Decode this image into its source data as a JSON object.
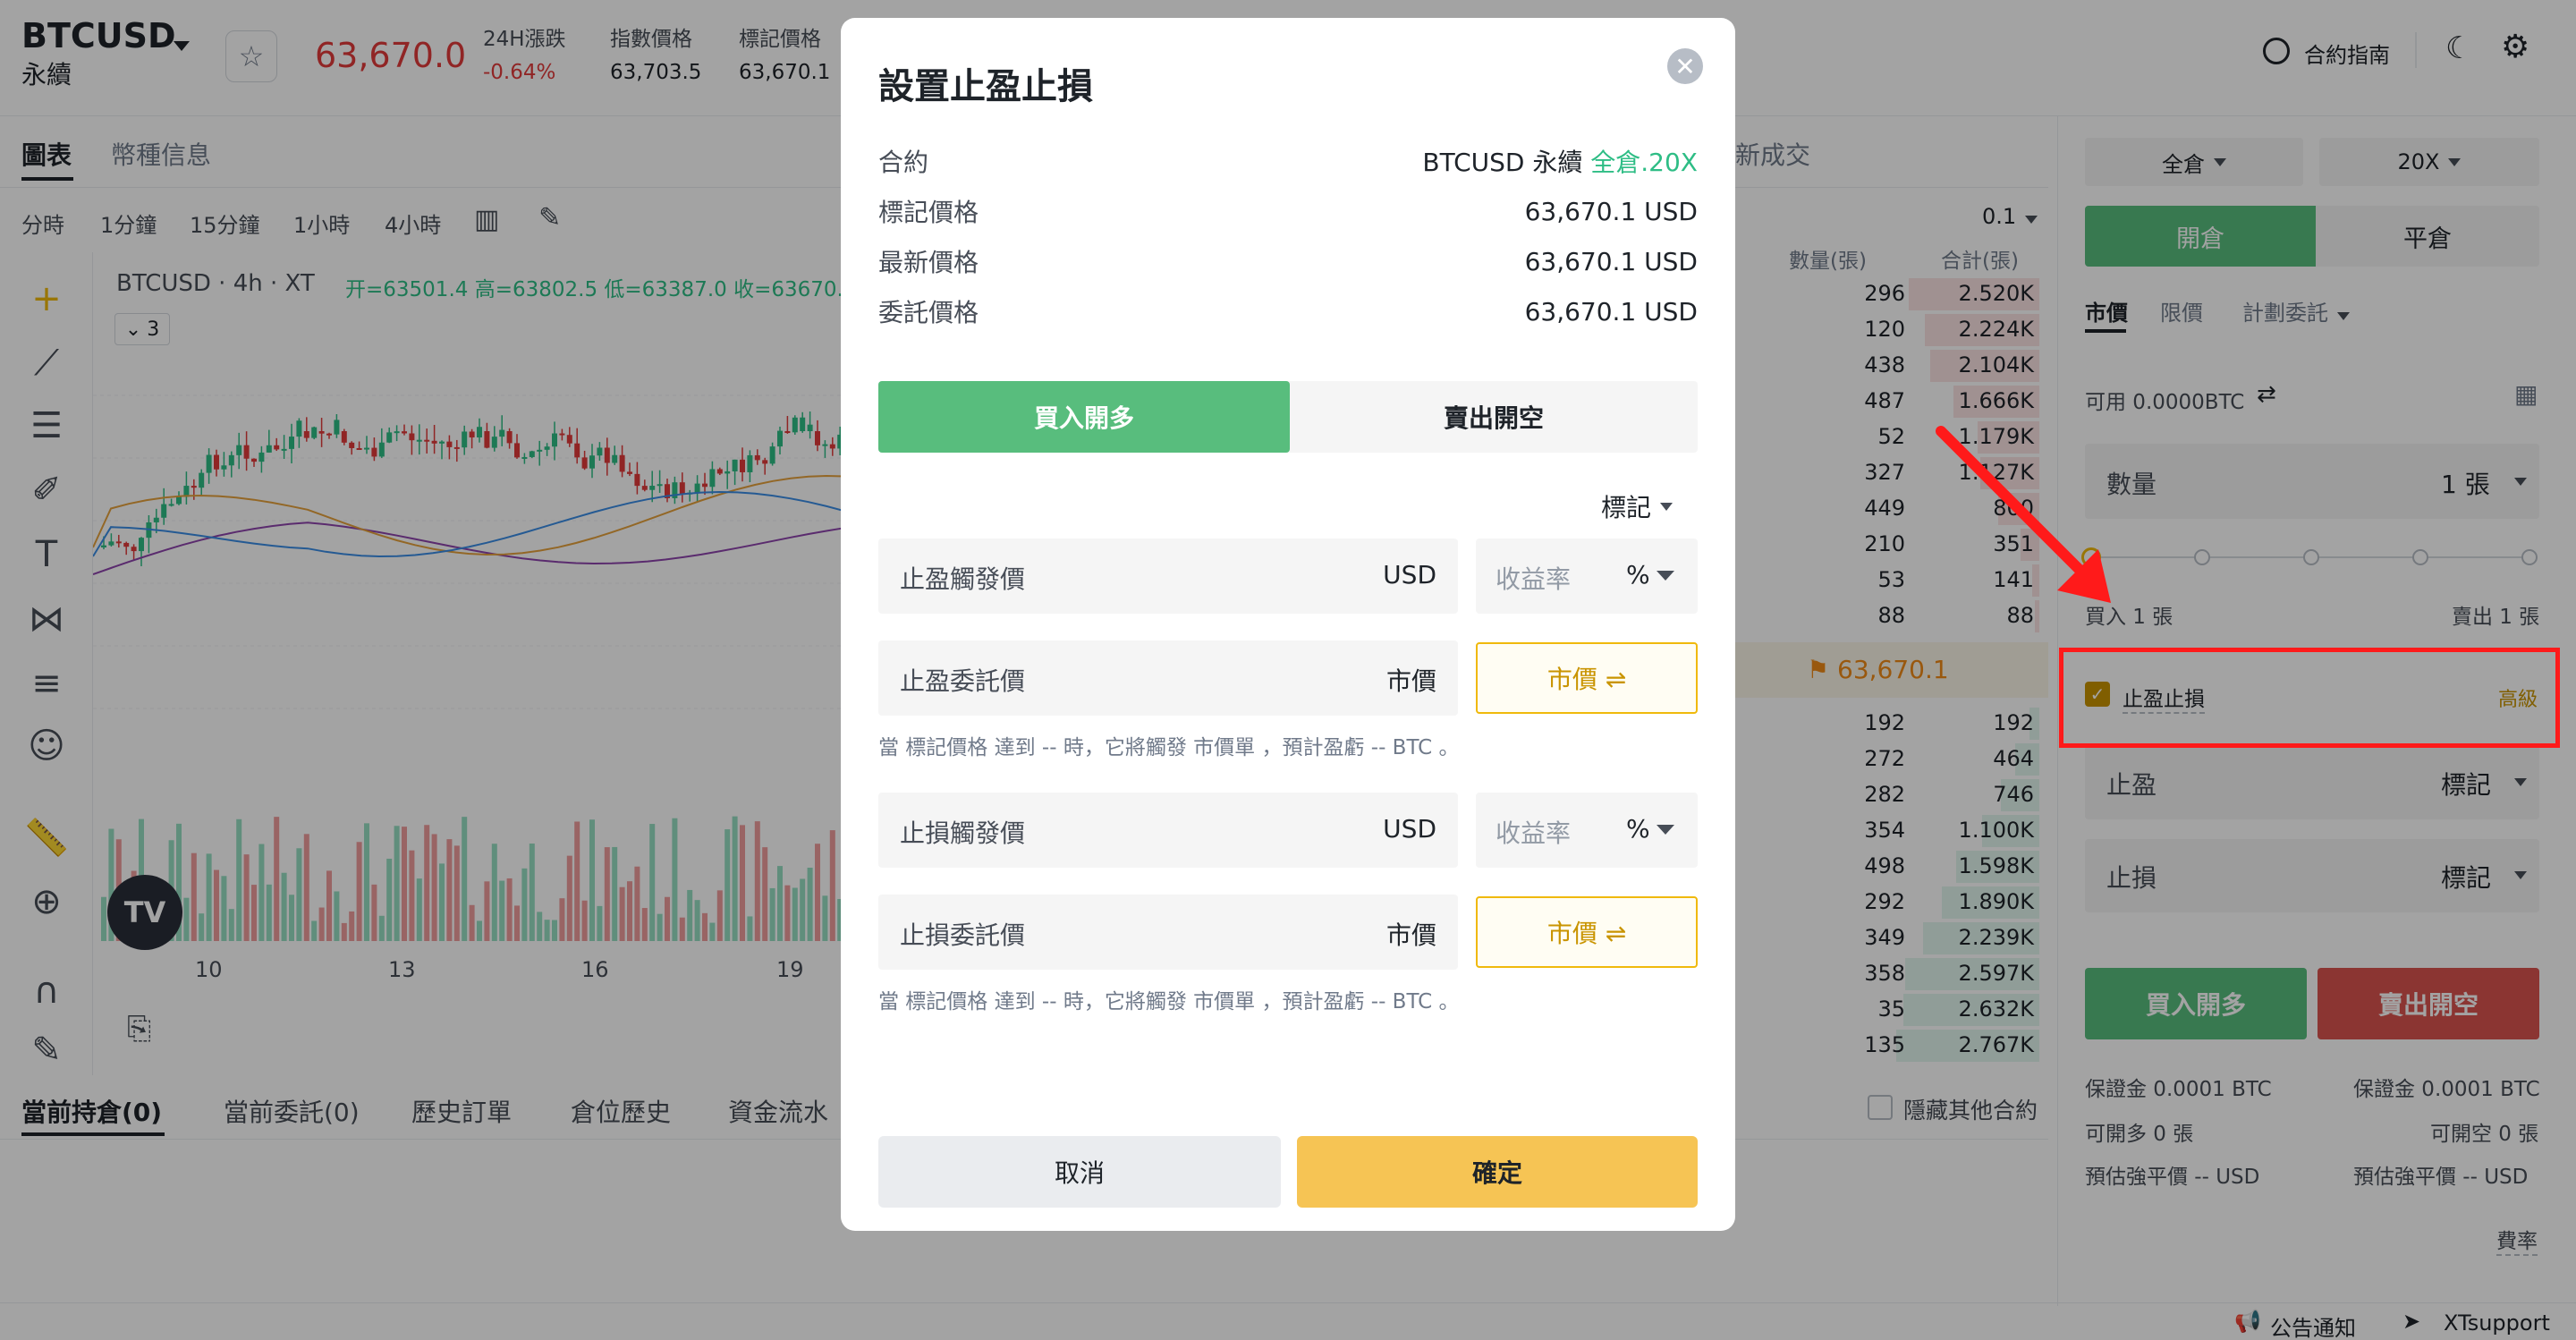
{
  "header": {
    "symbol": "BTCUSD",
    "symbol_sub": "永續",
    "last_price": "63,670.0",
    "stats": [
      {
        "label": "24H漲跌",
        "value": "-0.64%",
        "color": "#e23b3b"
      },
      {
        "label": "指數價格",
        "value": "63,703.5",
        "color": "#1e2329"
      },
      {
        "label": "標記價格",
        "value": "63,670.1",
        "color": "#1e2329"
      }
    ],
    "guide_label": "合約指南"
  },
  "chart_tabs": [
    "圖表",
    "幣種信息"
  ],
  "timeframes": [
    "分時",
    "1分鐘",
    "15分鐘",
    "1小時",
    "4小時"
  ],
  "chart": {
    "title": "BTCUSD · 4h · XT",
    "ohlc": "开=63501.4 高=63802.5 低=63387.0 收=63670.",
    "interval_badge": "3",
    "x_labels": [
      "10",
      "13",
      "16",
      "19"
    ],
    "logo_text": "TV"
  },
  "bottom_tabs": [
    "當前持倉(0)",
    "當前委託(0)",
    "歷史訂單",
    "倉位歷史",
    "資金流水"
  ],
  "hide_others_label": "隱藏其他合約",
  "order_book": {
    "latest_trades_label": "新成交",
    "precision": "0.1",
    "headers": [
      "數量(張)",
      "合計(張)"
    ],
    "asks": [
      {
        "qty": "296",
        "total": "2.520K",
        "depth": 0.91
      },
      {
        "qty": "120",
        "total": "2.224K",
        "depth": 0.8
      },
      {
        "qty": "438",
        "total": "2.104K",
        "depth": 0.76
      },
      {
        "qty": "487",
        "total": "1.666K",
        "depth": 0.6
      },
      {
        "qty": "52",
        "total": "1.179K",
        "depth": 0.43
      },
      {
        "qty": "327",
        "total": "1.127K",
        "depth": 0.41
      },
      {
        "qty": "449",
        "total": "800",
        "depth": 0.29
      },
      {
        "qty": "210",
        "total": "351",
        "depth": 0.13
      },
      {
        "qty": "53",
        "total": "141",
        "depth": 0.05
      },
      {
        "qty": "88",
        "total": "88",
        "depth": 0.03
      }
    ],
    "mid_price": "63,670.1",
    "bids": [
      {
        "qty": "192",
        "total": "192",
        "depth": 0.07
      },
      {
        "qty": "272",
        "total": "464",
        "depth": 0.17
      },
      {
        "qty": "282",
        "total": "746",
        "depth": 0.27
      },
      {
        "qty": "354",
        "total": "1.100K",
        "depth": 0.4
      },
      {
        "qty": "498",
        "total": "1.598K",
        "depth": 0.58
      },
      {
        "qty": "292",
        "total": "1.890K",
        "depth": 0.68
      },
      {
        "qty": "349",
        "total": "2.239K",
        "depth": 0.81
      },
      {
        "qty": "358",
        "total": "2.597K",
        "depth": 0.94
      },
      {
        "qty": "35",
        "total": "2.632K",
        "depth": 0.95
      },
      {
        "qty": "135",
        "total": "2.767K",
        "depth": 1.0
      }
    ]
  },
  "panel": {
    "margin_mode": "全倉",
    "leverage": "20X",
    "open_tab": "開倉",
    "close_tab": "平倉",
    "order_types": [
      "市價",
      "限價",
      "計劃委託"
    ],
    "available": "可用 0.0000BTC",
    "qty_label": "數量",
    "qty_value": "1 張",
    "buy_amount": "買入 1 張",
    "sell_amount": "賣出 1 張",
    "tpsl_label": "止盈止損",
    "advanced_label": "高級",
    "tp_label": "止盈",
    "sl_label": "止損",
    "mark_label": "標記",
    "buy_button": "買入開多",
    "sell_button": "賣出開空",
    "margin_buy": "保證金 0.0001 BTC",
    "margin_sell": "保證金 0.0001 BTC",
    "can_long": "可開多 0 張",
    "can_short": "可開空 0 張",
    "liq_buy": "預估強平價 -- USD",
    "liq_sell": "預估強平價 -- USD",
    "fee_label": "費率"
  },
  "footer": {
    "announce": "公告通知",
    "support": "XTsupport"
  },
  "modal": {
    "title": "設置止盈止損",
    "rows": [
      {
        "key": "合約",
        "value": "BTCUSD 永續",
        "extra": "全倉.20X"
      },
      {
        "key": "標記價格",
        "value": "63,670.1 USD",
        "extra": ""
      },
      {
        "key": "最新價格",
        "value": "63,670.1 USD",
        "extra": ""
      },
      {
        "key": "委託價格",
        "value": "63,670.1 USD",
        "extra": ""
      }
    ],
    "buy_tab": "買入開多",
    "sell_tab": "賣出開空",
    "price_type": "標記",
    "tp_trigger_label": "止盈觸發價",
    "tp_order_label": "止盈委託價",
    "sl_trigger_label": "止損觸發價",
    "sl_order_label": "止損委託價",
    "unit_usd": "USD",
    "unit_market": "市價",
    "yield_label": "收益率",
    "yield_unit": "%",
    "market_btn": "市價 ⇌",
    "tp_hint": "當 標記價格 達到 -- 時，它將觸發 市價單 ，預計盈虧 -- BTC 。",
    "sl_hint": "當 標記價格 達到 -- 時，它將觸發 市價單 ，預計盈虧 -- BTC 。",
    "cancel": "取消",
    "confirm": "確定"
  },
  "colors": {
    "up": "#2ebd85",
    "down": "#e23b3b",
    "buy": "#58bd7d",
    "sell": "#d9534f",
    "accent": "#f0b90b"
  }
}
